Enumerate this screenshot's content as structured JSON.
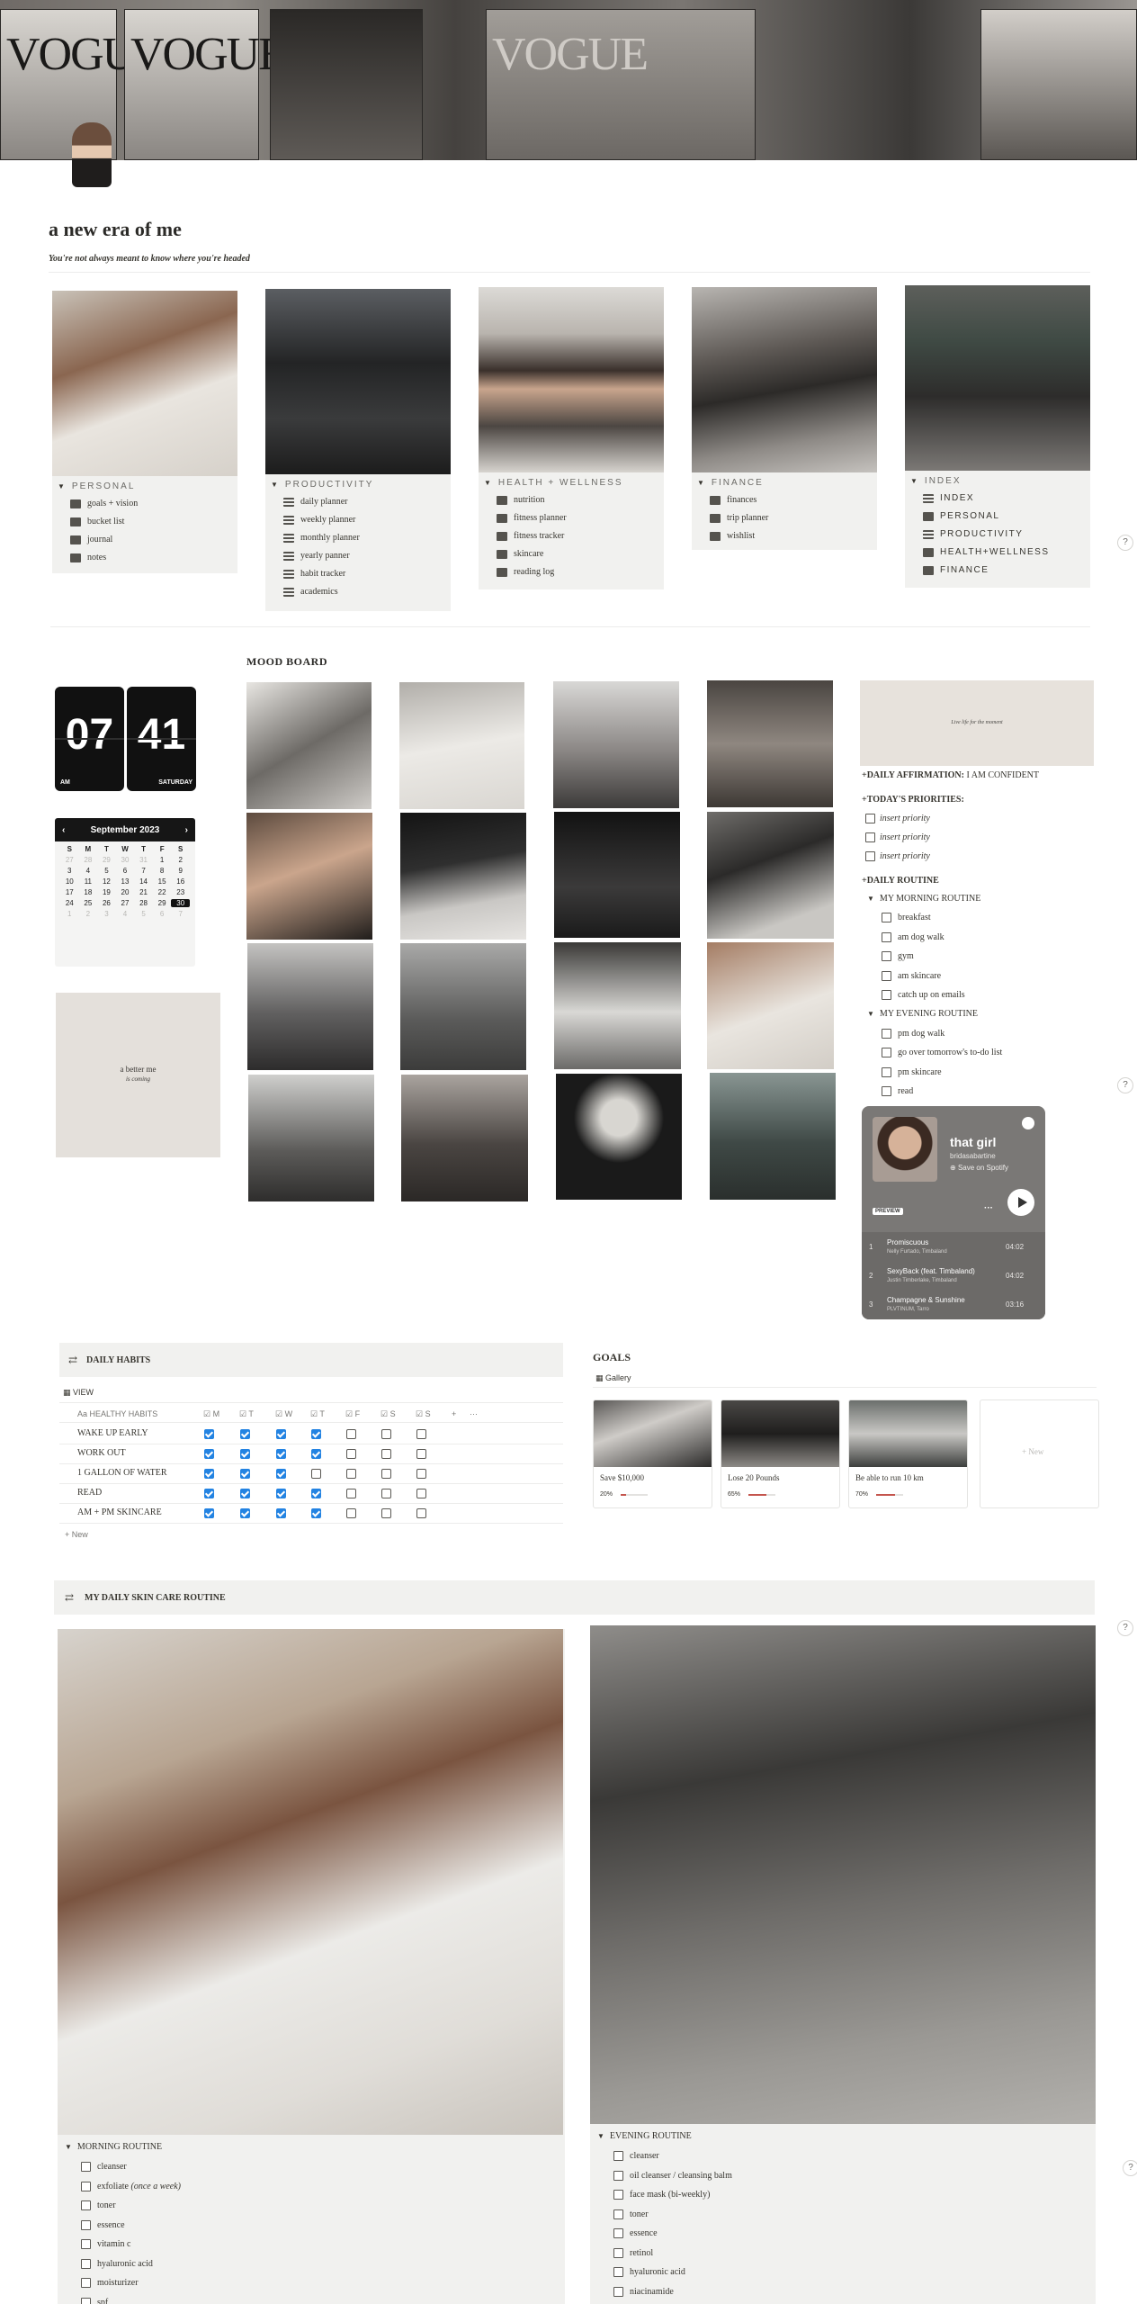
{
  "page": {
    "title": "a new era of me",
    "subtitle": "You're not always meant to know where you're headed"
  },
  "cover": {
    "magazine_text": [
      "VOGUE",
      "VOGUE",
      "VOGUE"
    ]
  },
  "categories": [
    {
      "label": "PERSONAL",
      "items": [
        "goals + vision",
        "bucket list",
        "journal",
        "notes"
      ]
    },
    {
      "label": "PRODUCTIVITY",
      "items": [
        "daily planner",
        "weekly planner",
        "monthly planner",
        "yearly panner",
        "habit tracker",
        "academics"
      ]
    },
    {
      "label": "HEALTH + WELLNESS",
      "items": [
        "nutrition",
        "fitness planner",
        "fitness tracker",
        "skincare",
        "reading log"
      ]
    },
    {
      "label": "FINANCE",
      "items": [
        "finances",
        "trip planner",
        "wishlist"
      ]
    },
    {
      "label": "INDEX",
      "items": [
        "INDEX",
        "PERSONAL",
        "PRODUCTIVITY",
        "HEALTH+WELLNESS",
        "FINANCE"
      ]
    }
  ],
  "help_label": "?",
  "clock": {
    "hour": "07",
    "minute": "41",
    "ampm": "AM",
    "day": "SATURDAY"
  },
  "calendar": {
    "month": "September 2023",
    "prev": "‹",
    "next": "›",
    "dow": [
      "S",
      "M",
      "T",
      "W",
      "T",
      "F",
      "S"
    ],
    "days": [
      "27",
      "28",
      "29",
      "30",
      "31",
      "1",
      "2",
      "3",
      "4",
      "5",
      "6",
      "7",
      "8",
      "9",
      "10",
      "11",
      "12",
      "13",
      "14",
      "15",
      "16",
      "17",
      "18",
      "19",
      "20",
      "21",
      "22",
      "23",
      "24",
      "25",
      "26",
      "27",
      "28",
      "29",
      "30",
      "1",
      "2",
      "3",
      "4",
      "5",
      "6",
      "7"
    ]
  },
  "better_card": {
    "line1": "a better me",
    "line2": "is coming"
  },
  "mood_board": {
    "title": "MOOD BOARD"
  },
  "quote_card": {
    "text": "Live life for the moment"
  },
  "daily": {
    "affirmation_label": "+DAILY AFFIRMATION:",
    "affirmation_value": " I AM CONFIDENT",
    "priorities_label": "+TODAY'S PRIORITIES:",
    "priorities": [
      "insert priority",
      "insert priority",
      "insert priority"
    ],
    "routine_label": "+DAILY ROUTINE",
    "morning_label": "MY MORNING ROUTINE",
    "morning": [
      "breakfast",
      "am dog walk",
      "gym",
      "am skincare",
      "catch up on emails"
    ],
    "evening_label": "MY EVENING ROUTINE",
    "evening": [
      "pm dog walk",
      "go over tomorrow's to-do list",
      "pm skincare",
      "read"
    ]
  },
  "spotify": {
    "playlist": "that girl",
    "owner": "bridasabartine",
    "save": "Save on Spotify",
    "preview": "PREVIEW",
    "more": "···",
    "tracks": [
      {
        "n": "1",
        "title": "Promiscuous",
        "artist": "Nelly Furtado, Timbaland",
        "dur": "04:02"
      },
      {
        "n": "2",
        "title": "SexyBack (feat. Timbaland)",
        "artist": "Justin Timberlake, Timbaland",
        "dur": "04:02"
      },
      {
        "n": "3",
        "title": "Champagne & Sunshine",
        "artist": "PLVTINUM, Tarro",
        "dur": "03:16"
      }
    ]
  },
  "habits": {
    "title": "DAILY HABITS",
    "view": "VIEW",
    "name_col": "HEALTHY HABITS",
    "days": [
      "M",
      "T",
      "W",
      "T",
      "F",
      "S",
      "S"
    ],
    "add_col": "+",
    "more_col": "···",
    "rows": [
      {
        "name": "WAKE UP EARLY",
        "checks": [
          1,
          1,
          1,
          1,
          0,
          0,
          0
        ]
      },
      {
        "name": "WORK OUT",
        "checks": [
          1,
          1,
          1,
          1,
          0,
          0,
          0
        ]
      },
      {
        "name": "1 GALLON OF WATER",
        "checks": [
          1,
          1,
          1,
          0,
          0,
          0,
          0
        ]
      },
      {
        "name": "READ",
        "checks": [
          1,
          1,
          1,
          1,
          0,
          0,
          0
        ]
      },
      {
        "name": "AM + PM SKINCARE",
        "checks": [
          1,
          1,
          1,
          1,
          0,
          0,
          0
        ]
      }
    ],
    "new_label": "+ New"
  },
  "goals": {
    "title": "GOALS",
    "view": "Gallery",
    "items": [
      {
        "title": "Save $10,000",
        "progress": 0.2,
        "label": "20%"
      },
      {
        "title": "Lose 20 Pounds",
        "progress": 0.65,
        "label": "65%"
      },
      {
        "title": "Be able to run 10 km",
        "progress": 0.7,
        "label": "70%"
      }
    ],
    "new_label": "+ New"
  },
  "skincare": {
    "title": "MY DAILY SKIN CARE ROUTINE",
    "morning_label": "MORNING ROUTINE",
    "morning": [
      "cleanser",
      "exfoliate",
      "toner",
      "essence",
      "vitamin c",
      "hyaluronic acid",
      "moisturizer",
      "spf"
    ],
    "exfoliate_note": "(once a week)",
    "evening_label": "EVENING ROUTINE",
    "evening": [
      "cleanser",
      "oil cleanser / cleansing balm",
      "face mask (bi-weekly)",
      "toner",
      "essence",
      "retinol",
      "hyaluronic acid",
      "niacinamide"
    ]
  },
  "colors": {
    "checkbox_blue": "#2383e2",
    "panel_gray": "#f1f1ef",
    "progress_red": "#c4554d"
  }
}
